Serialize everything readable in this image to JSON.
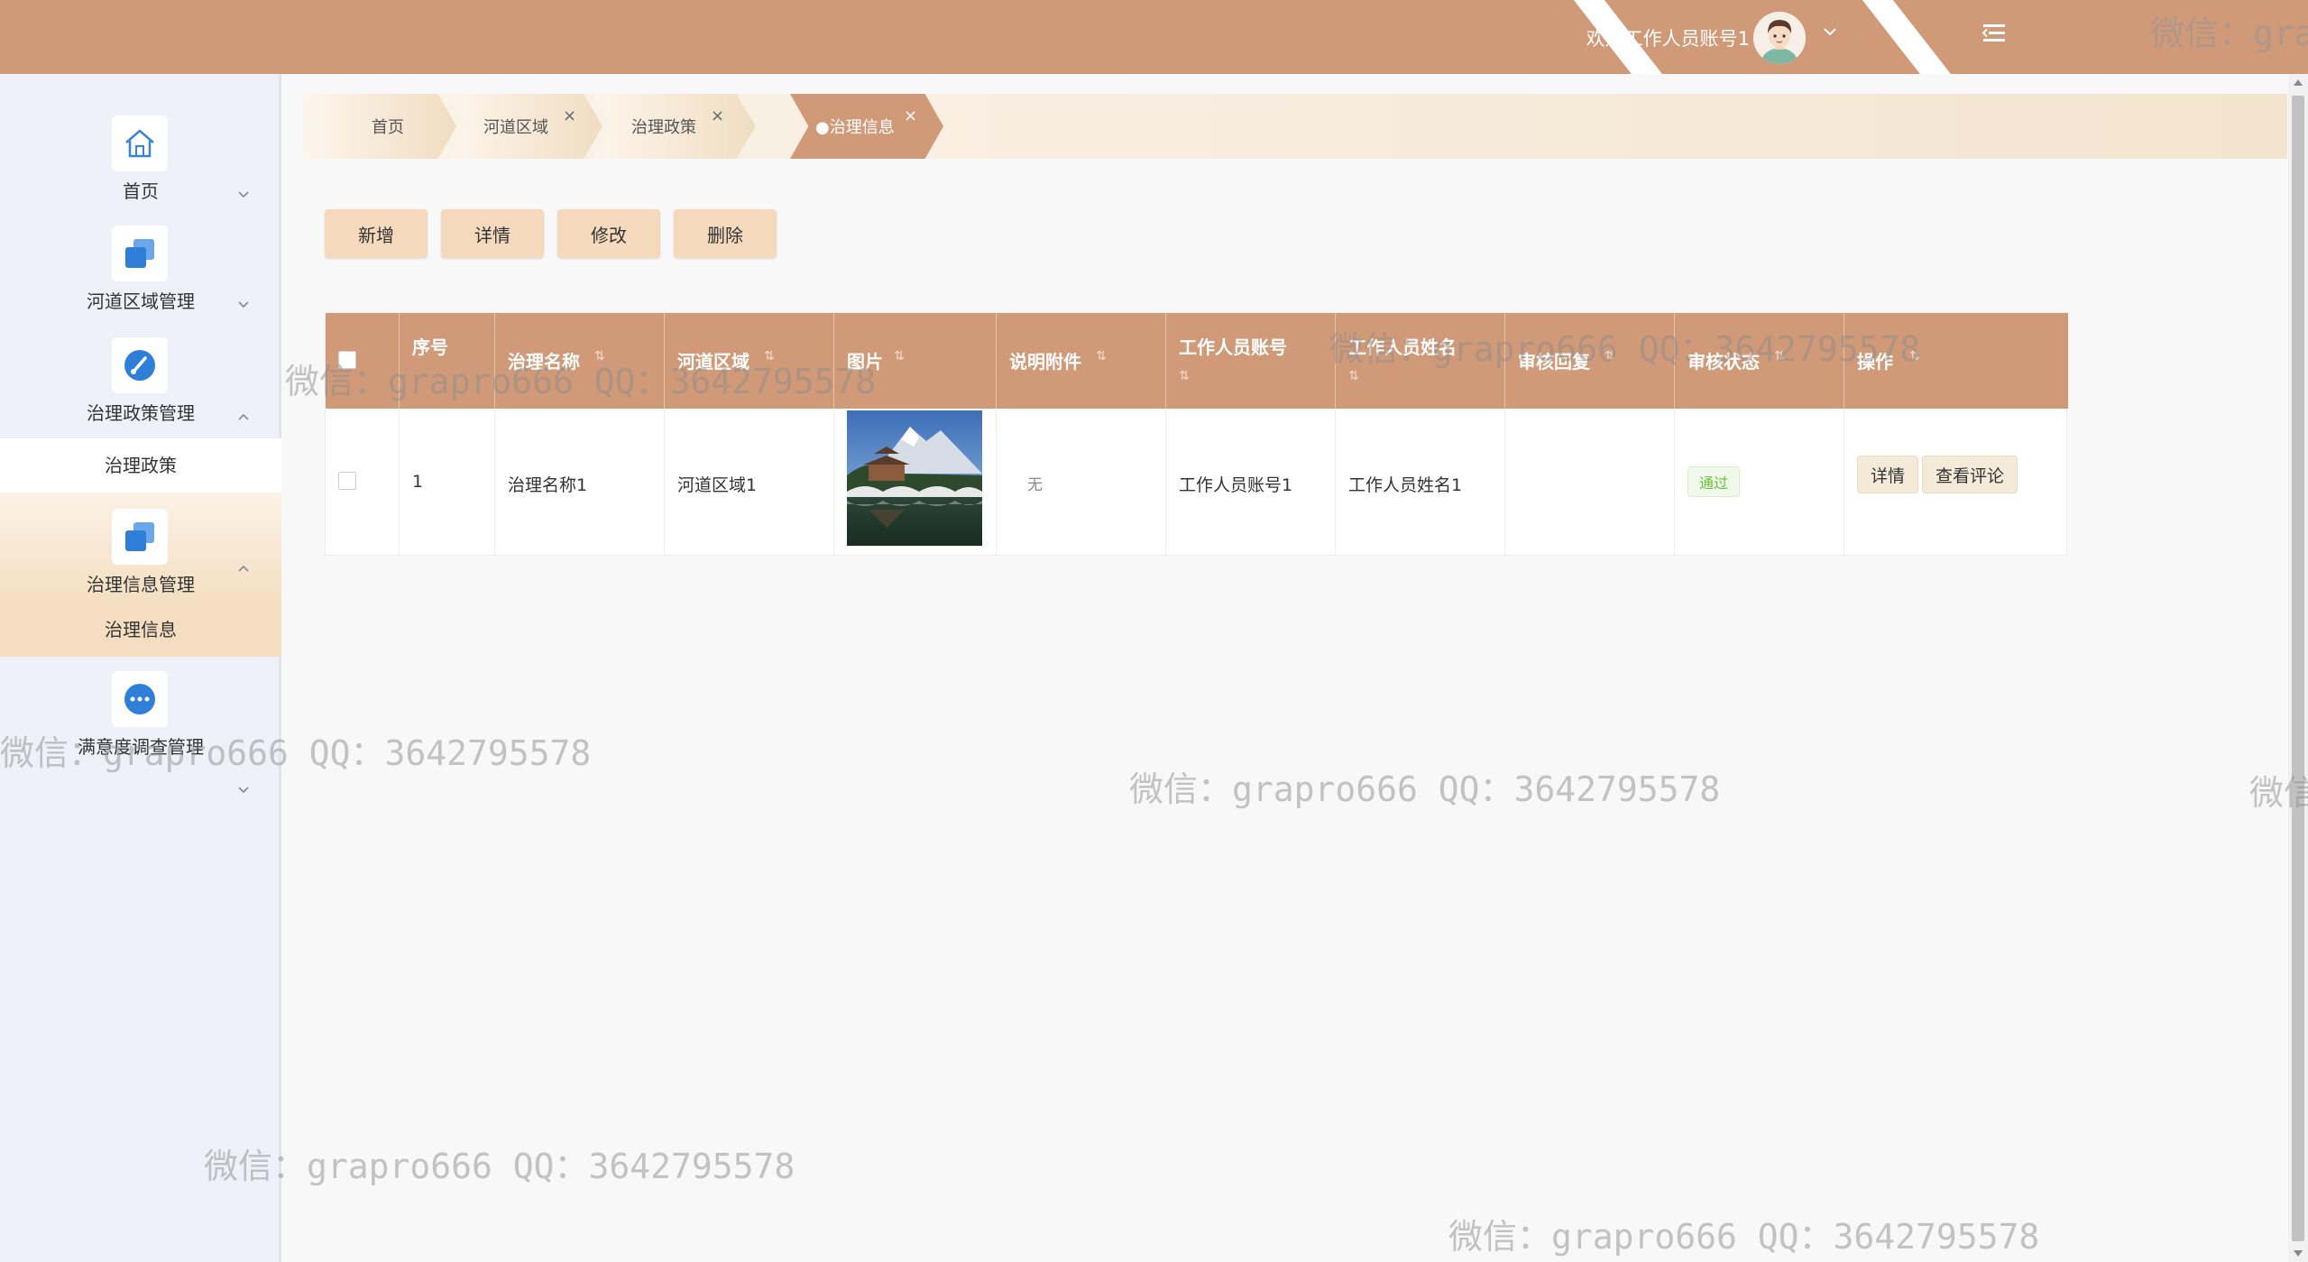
{
  "header": {
    "welcome_text": "欢迎工作人员账号1",
    "accent_color": "#d09a78"
  },
  "sidebar": {
    "groups": [
      {
        "label": "首页",
        "icon": "home-icon"
      },
      {
        "label": "河道区域管理",
        "icon": "copy-icon"
      },
      {
        "label": "治理政策管理",
        "icon": "gauge-icon",
        "sub": [
          "治理政策"
        ]
      },
      {
        "label": "治理信息管理",
        "icon": "copy-icon",
        "sub": [
          "治理信息"
        ]
      },
      {
        "label": "满意度调查管理",
        "icon": "more-icon"
      }
    ]
  },
  "tabs": [
    {
      "label": "首页"
    },
    {
      "label": "河道区域"
    },
    {
      "label": "治理政策"
    },
    {
      "label": "●治理信息"
    }
  ],
  "toolbar": {
    "add": "新增",
    "detail": "详情",
    "edit": "修改",
    "delete": "删除"
  },
  "table": {
    "columns": [
      "序号",
      "治理名称",
      "河道区域",
      "图片",
      "说明附件",
      "工作人员账号",
      "工作人员姓名",
      "审核回复",
      "审核状态",
      "操作"
    ],
    "rows": [
      {
        "index": "1",
        "name": "治理名称1",
        "area": "河道区域1",
        "image": "landscape-photo",
        "attachment": "无",
        "account": "工作人员账号1",
        "staff_name": "工作人员姓名1",
        "reply": "",
        "status": "通过",
        "actions": [
          "详情",
          "查看评论"
        ]
      }
    ],
    "status_color": "#67c23a"
  },
  "watermark": "微信：grapro666 QQ：3642795578"
}
